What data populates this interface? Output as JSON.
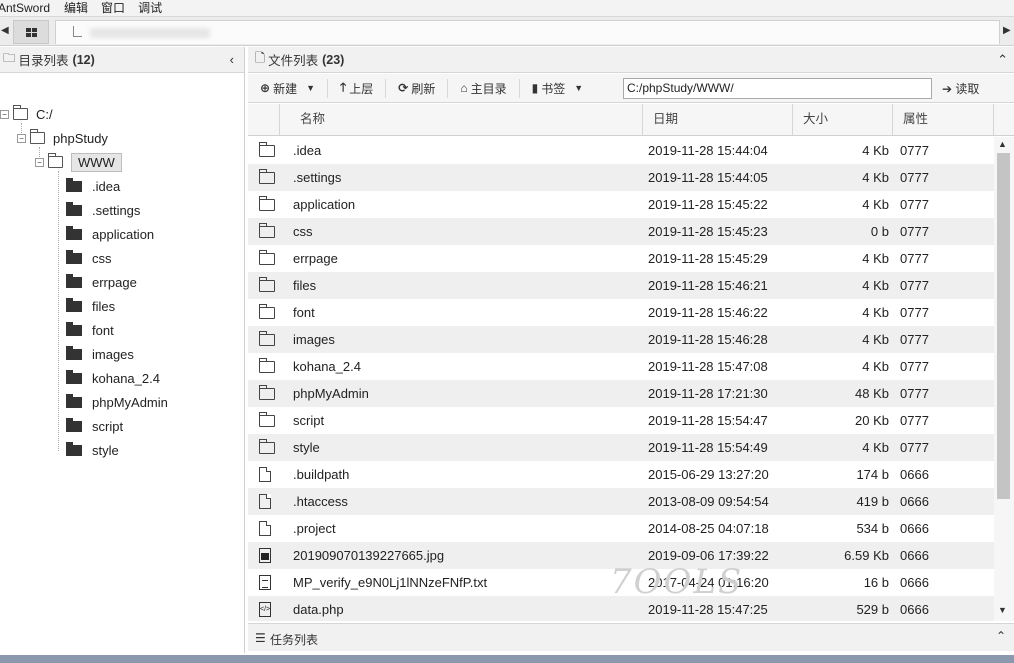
{
  "menu": {
    "app": "AntSword",
    "edit": "编辑",
    "window": "窗口",
    "debug": "调试"
  },
  "left": {
    "title": "目录列表",
    "count": "(12)",
    "tree": {
      "root": "C:/",
      "l1": "phpStudy",
      "l2": "WWW",
      "children": [
        ".idea",
        ".settings",
        "application",
        "css",
        "errpage",
        "files",
        "font",
        "images",
        "kohana_2.4",
        "phpMyAdmin",
        "script",
        "style"
      ]
    }
  },
  "right": {
    "title": "文件列表",
    "count": "(23)",
    "toolbar": {
      "new": "新建",
      "up": "上层",
      "refresh": "刷新",
      "home": "主目录",
      "bookmark": "书签",
      "path": "C:/phpStudy/WWW/",
      "read": "读取"
    },
    "columns": {
      "name": "名称",
      "date": "日期",
      "size": "大小",
      "attr": "属性"
    },
    "files": [
      {
        "icon": "folder-icon",
        "name": ".idea",
        "date": "2019-11-28 15:44:04",
        "size": "4 Kb",
        "attr": "0777"
      },
      {
        "icon": "folder-icon",
        "name": ".settings",
        "date": "2019-11-28 15:44:05",
        "size": "4 Kb",
        "attr": "0777"
      },
      {
        "icon": "folder-icon",
        "name": "application",
        "date": "2019-11-28 15:45:22",
        "size": "4 Kb",
        "attr": "0777"
      },
      {
        "icon": "folder-icon",
        "name": "css",
        "date": "2019-11-28 15:45:23",
        "size": "0 b",
        "attr": "0777"
      },
      {
        "icon": "folder-icon",
        "name": "errpage",
        "date": "2019-11-28 15:45:29",
        "size": "4 Kb",
        "attr": "0777"
      },
      {
        "icon": "folder-icon",
        "name": "files",
        "date": "2019-11-28 15:46:21",
        "size": "4 Kb",
        "attr": "0777"
      },
      {
        "icon": "folder-icon",
        "name": "font",
        "date": "2019-11-28 15:46:22",
        "size": "4 Kb",
        "attr": "0777"
      },
      {
        "icon": "folder-icon",
        "name": "images",
        "date": "2019-11-28 15:46:28",
        "size": "4 Kb",
        "attr": "0777"
      },
      {
        "icon": "folder-icon",
        "name": "kohana_2.4",
        "date": "2019-11-28 15:47:08",
        "size": "4 Kb",
        "attr": "0777"
      },
      {
        "icon": "folder-icon",
        "name": "phpMyAdmin",
        "date": "2019-11-28 17:21:30",
        "size": "48 Kb",
        "attr": "0777"
      },
      {
        "icon": "folder-icon",
        "name": "script",
        "date": "2019-11-28 15:54:47",
        "size": "20 Kb",
        "attr": "0777"
      },
      {
        "icon": "folder-icon",
        "name": "style",
        "date": "2019-11-28 15:54:49",
        "size": "4 Kb",
        "attr": "0777"
      },
      {
        "icon": "file-icon",
        "name": ".buildpath",
        "date": "2015-06-29 13:27:20",
        "size": "174 b",
        "attr": "0666"
      },
      {
        "icon": "file-icon",
        "name": ".htaccess",
        "date": "2013-08-09 09:54:54",
        "size": "419 b",
        "attr": "0666"
      },
      {
        "icon": "file-icon",
        "name": ".project",
        "date": "2014-08-25 04:07:18",
        "size": "534 b",
        "attr": "0666"
      },
      {
        "icon": "image-file-icon",
        "name": "201909070139227665.jpg",
        "date": "2019-09-06 17:39:22",
        "size": "6.59 Kb",
        "attr": "0666"
      },
      {
        "icon": "text-file-icon",
        "name": "MP_verify_e9N0Lj1lNNzeFNfP.txt",
        "date": "2017-04-24 01:16:20",
        "size": "16 b",
        "attr": "0666"
      },
      {
        "icon": "code-file-icon",
        "name": "data.php",
        "date": "2019-11-28 15:47:25",
        "size": "529 b",
        "attr": "0666"
      }
    ]
  },
  "tasks": {
    "title": "任务列表"
  },
  "watermark": "7OOLS"
}
